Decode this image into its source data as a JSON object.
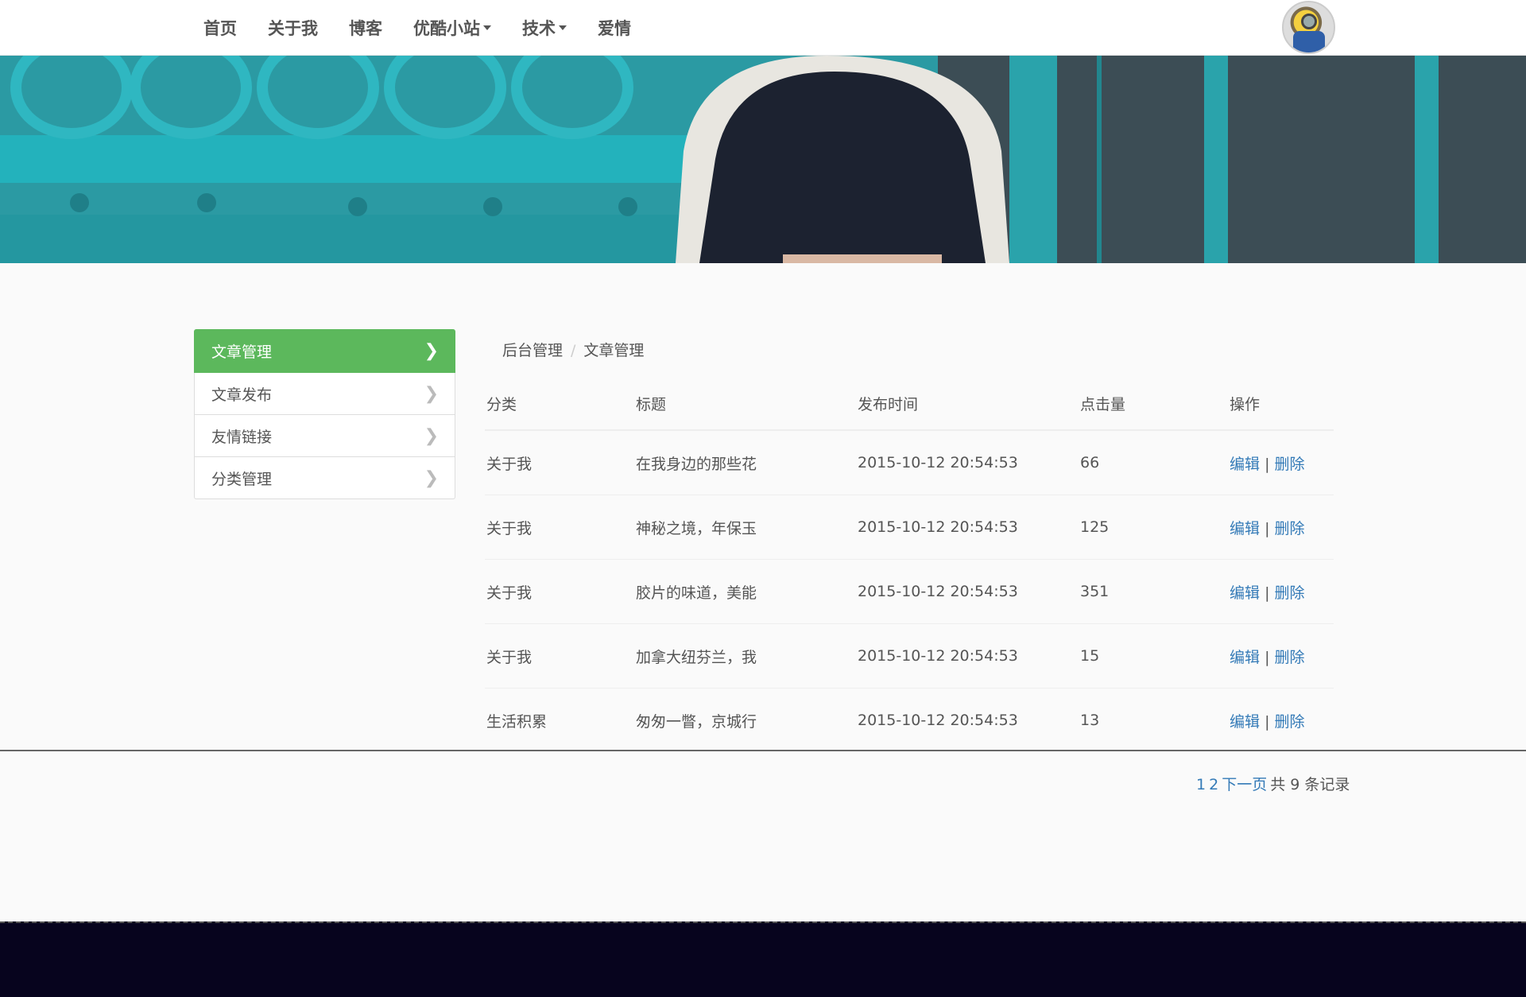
{
  "nav": {
    "items": [
      {
        "label": "首页",
        "dropdown": false
      },
      {
        "label": "关于我",
        "dropdown": false
      },
      {
        "label": "博客",
        "dropdown": false
      },
      {
        "label": "优酷小站",
        "dropdown": true
      },
      {
        "label": "技术",
        "dropdown": true
      },
      {
        "label": "爱情",
        "dropdown": false
      }
    ]
  },
  "sidebar": {
    "items": [
      {
        "label": "文章管理",
        "active": true
      },
      {
        "label": "文章发布",
        "active": false
      },
      {
        "label": "友情链接",
        "active": false
      },
      {
        "label": "分类管理",
        "active": false
      }
    ]
  },
  "breadcrumb": {
    "parent": "后台管理",
    "separator": "/",
    "current": "文章管理"
  },
  "table": {
    "headers": [
      "分类",
      "标题",
      "发布时间",
      "点击量",
      "操作"
    ],
    "rows": [
      {
        "category": "关于我",
        "title": "在我身边的那些花",
        "time": "2015-10-12 20:54:53",
        "hits": "66",
        "edit": "编辑",
        "sep": "|",
        "delete": "删除"
      },
      {
        "category": "关于我",
        "title": "神秘之境，年保玉",
        "time": "2015-10-12 20:54:53",
        "hits": "125",
        "edit": "编辑",
        "sep": "|",
        "delete": "删除"
      },
      {
        "category": "关于我",
        "title": "胶片的味道，美能",
        "time": "2015-10-12 20:54:53",
        "hits": "351",
        "edit": "编辑",
        "sep": "|",
        "delete": "删除"
      },
      {
        "category": "关于我",
        "title": "加拿大纽芬兰，我",
        "time": "2015-10-12 20:54:53",
        "hits": "15",
        "edit": "编辑",
        "sep": "|",
        "delete": "删除"
      },
      {
        "category": "生活积累",
        "title": "匆匆一瞥，京城行",
        "time": "2015-10-12 20:54:53",
        "hits": "13",
        "edit": "编辑",
        "sep": "|",
        "delete": "删除"
      }
    ]
  },
  "pagination": {
    "page1": "1",
    "page2": "2",
    "next": "下一页",
    "summary_prefix": "共",
    "total": "9",
    "summary_suffix": "条记录"
  },
  "colors": {
    "active_green": "#5cb85c",
    "link_blue": "#337ab7",
    "footer_dark": "#07041e"
  },
  "icons": [
    "chevron-right-icon",
    "caret-down-icon",
    "avatar-image"
  ]
}
